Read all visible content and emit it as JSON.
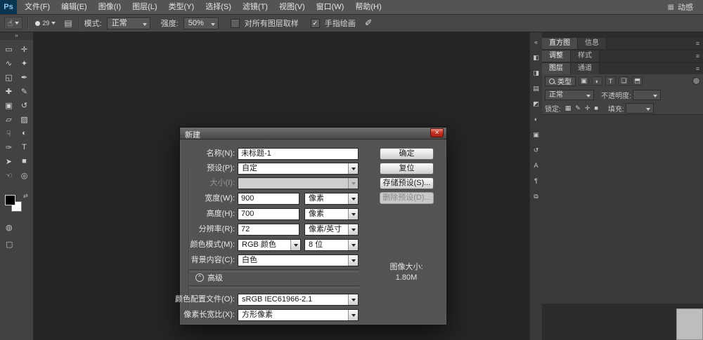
{
  "app": {
    "logo": "Ps",
    "workspace": "动感",
    "workspace_icon": "▦"
  },
  "menu": {
    "items": [
      "文件(F)",
      "编辑(E)",
      "图像(I)",
      "图层(L)",
      "类型(Y)",
      "选择(S)",
      "滤镜(T)",
      "视图(V)",
      "窗口(W)",
      "帮助(H)"
    ]
  },
  "options": {
    "tool_icon": "☝",
    "brush_size": "29",
    "panel_toggle_icon": "▤",
    "mode_label": "模式:",
    "mode_value": "正常",
    "strength_label": "强度:",
    "strength_value": "50%",
    "sample_all_label": "对所有图层取样",
    "finger_paint_label": "手指绘画",
    "check_glyph": "✓",
    "airbrush_icon": "✐"
  },
  "toolbar": {
    "collapse_icon": "»",
    "swap_icon": "⇄",
    "quick_mask_icon": "◍",
    "screen_mode_icon": "▢",
    "tools": [
      {
        "name": "rectangular-marquee",
        "glyph": "▭"
      },
      {
        "name": "move",
        "glyph": "✛"
      },
      {
        "name": "lasso",
        "glyph": "∿"
      },
      {
        "name": "quick-selection",
        "glyph": "✦"
      },
      {
        "name": "crop",
        "glyph": "◱"
      },
      {
        "name": "eyedropper",
        "glyph": "✒"
      },
      {
        "name": "spot-healing-brush",
        "glyph": "✚"
      },
      {
        "name": "brush",
        "glyph": "✎"
      },
      {
        "name": "clone-stamp",
        "glyph": "▣"
      },
      {
        "name": "history-brush",
        "glyph": "↺"
      },
      {
        "name": "eraser",
        "glyph": "▱"
      },
      {
        "name": "gradient",
        "glyph": "▨"
      },
      {
        "name": "smudge",
        "glyph": "☟"
      },
      {
        "name": "dodge",
        "glyph": "◐"
      },
      {
        "name": "pen",
        "glyph": "✑"
      },
      {
        "name": "type",
        "glyph": "T"
      },
      {
        "name": "path-selection",
        "glyph": "➤"
      },
      {
        "name": "shape",
        "glyph": "■"
      },
      {
        "name": "hand",
        "glyph": "☜"
      },
      {
        "name": "zoom",
        "glyph": "◎"
      }
    ]
  },
  "dock": {
    "icons": [
      {
        "name": "collapse-panels",
        "glyph": "«"
      },
      {
        "name": "navigator",
        "glyph": "◧"
      },
      {
        "name": "color",
        "glyph": "◨"
      },
      {
        "name": "swatches",
        "glyph": "▤"
      },
      {
        "name": "styles",
        "glyph": "◩"
      },
      {
        "name": "adjustments",
        "glyph": "◐"
      },
      {
        "name": "masks",
        "glyph": "▣"
      },
      {
        "name": "history",
        "glyph": "↺"
      },
      {
        "name": "character",
        "glyph": "A"
      },
      {
        "name": "paragraph",
        "glyph": "¶"
      },
      {
        "name": "clone-source",
        "glyph": "⧉"
      }
    ]
  },
  "panels": {
    "menu_icon": "≡",
    "group1": {
      "tabs": [
        "直方图",
        "信息"
      ]
    },
    "group2": {
      "tabs": [
        "调整",
        "样式"
      ]
    },
    "group3": {
      "tabs": [
        "图层",
        "通道"
      ]
    },
    "layers": {
      "filter_label": "类型",
      "filter_icons": [
        "▣",
        "◐",
        "T",
        "❏",
        "⬒"
      ],
      "blend_value": "正常",
      "opacity_label": "不透明度:",
      "lock_label": "锁定:",
      "lock_icons": [
        "▦",
        "✎",
        "✛",
        "■"
      ],
      "fill_label": "填充:"
    }
  },
  "dialog": {
    "title": "新建",
    "close_glyph": "×",
    "name_label": "名称(N):",
    "name_value": "未标题-1",
    "preset_label": "预设(P):",
    "preset_value": "自定",
    "size_label": "大小(I):",
    "width_label": "宽度(W):",
    "width_value": "900",
    "width_unit": "像素",
    "height_label": "高度(H):",
    "height_value": "700",
    "height_unit": "像素",
    "resolution_label": "分辨率(R):",
    "resolution_value": "72",
    "resolution_unit": "像素/英寸",
    "color_mode_label": "颜色模式(M):",
    "color_mode_value": "RGB 颜色",
    "bit_depth_value": "8 位",
    "background_label": "背景内容(C):",
    "background_value": "白色",
    "advanced_icon": "^",
    "advanced_label": "高级",
    "profile_label": "颜色配置文件(O):",
    "profile_value": "sRGB IEC61966-2.1",
    "aspect_label": "像素长宽比(X):",
    "aspect_value": "方形像素",
    "ok_label": "确定",
    "reset_label": "复位",
    "save_preset_label": "存储预设(S)...",
    "delete_preset_label": "删除预设(D)...",
    "image_size_label": "图像大小:",
    "image_size_value": "1.80M"
  }
}
